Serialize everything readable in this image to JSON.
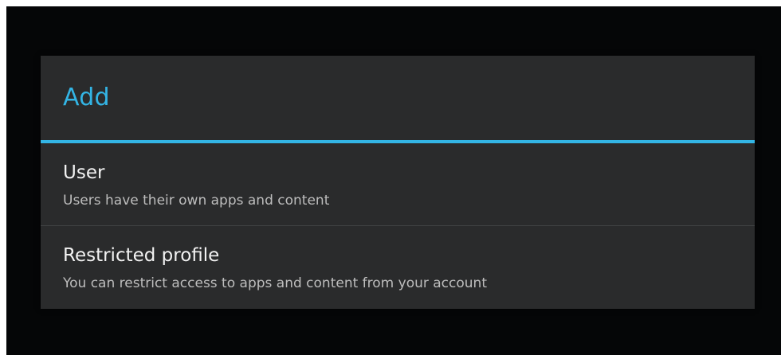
{
  "dialog": {
    "title": "Add",
    "accent_color": "#33b5e5",
    "options": [
      {
        "title": "User",
        "description": "Users have their own apps and content"
      },
      {
        "title": "Restricted profile",
        "description": "You can restrict access to apps and content from your account"
      }
    ]
  }
}
